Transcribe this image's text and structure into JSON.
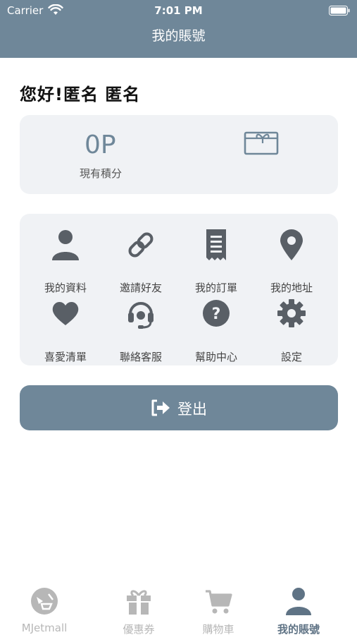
{
  "status_bar": {
    "carrier": "Carrier",
    "time": "7:01 PM"
  },
  "header": {
    "title": "我的賬號"
  },
  "greeting": "您好!匿名 匿名",
  "points": {
    "value": "0P",
    "label": "現有積分"
  },
  "menu": [
    {
      "label": "我的資料",
      "icon": "user-icon"
    },
    {
      "label": "邀請好友",
      "icon": "link-icon"
    },
    {
      "label": "我的訂單",
      "icon": "receipt-icon"
    },
    {
      "label": "我的地址",
      "icon": "map-pin-icon"
    },
    {
      "label": "喜愛清單",
      "icon": "heart-icon"
    },
    {
      "label": "聯絡客服",
      "icon": "headset-icon"
    },
    {
      "label": "幫助中心",
      "icon": "question-icon"
    },
    {
      "label": "設定",
      "icon": "gear-icon"
    }
  ],
  "logout": {
    "label": "登出",
    "icon": "sign-out-icon"
  },
  "tabs": [
    {
      "label": "MJetmall",
      "icon": "mjetmall-logo-icon",
      "active": false
    },
    {
      "label": "優惠券",
      "icon": "gift-icon",
      "active": false
    },
    {
      "label": "購物車",
      "icon": "cart-icon",
      "active": false
    },
    {
      "label": "我的賬號",
      "icon": "user-icon",
      "active": true
    }
  ],
  "colors": {
    "primary": "#6f8799",
    "card_bg": "#f0f2f5",
    "icon": "#595f66",
    "tab_inactive": "#b7b7b7"
  }
}
